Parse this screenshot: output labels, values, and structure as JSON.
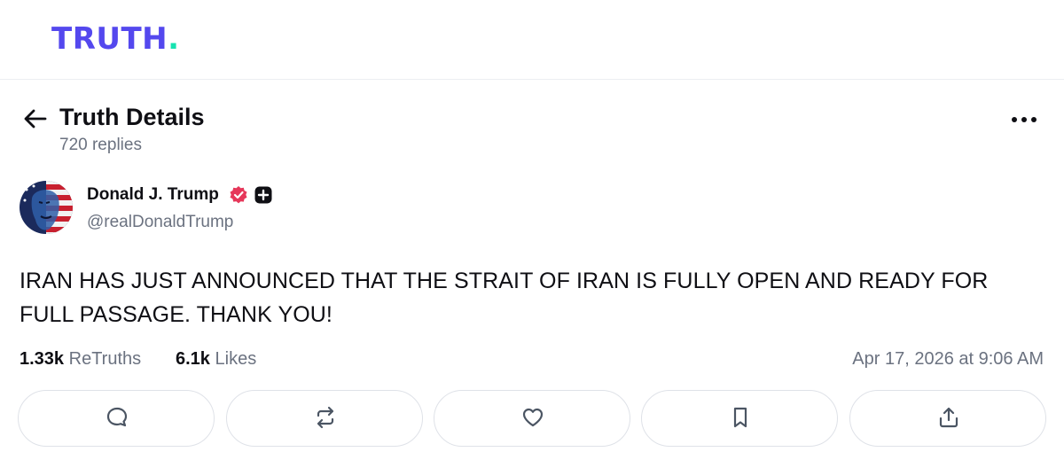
{
  "brand": {
    "logo_text": "TRUTH",
    "logo_dot": ".",
    "colors": {
      "primary": "#5448ee",
      "accent": "#17e3b0",
      "verified": "#e6375a"
    }
  },
  "header": {
    "title": "Truth Details",
    "replies": "720 replies",
    "back_icon": "arrow-left-icon",
    "more_icon": "more-horizontal-icon"
  },
  "post": {
    "author": {
      "name": "Donald J. Trump",
      "handle": "@realDonaldTrump",
      "verified": true,
      "badge": "plus-badge-icon"
    },
    "text": "IRAN HAS JUST ANNOUNCED THAT THE STRAIT OF IRAN IS FULLY OPEN AND READY FOR FULL PASSAGE. THANK YOU!",
    "stats": {
      "retruths_count": "1.33k",
      "retruths_label": "ReTruths",
      "likes_count": "6.1k",
      "likes_label": "Likes"
    },
    "timestamp": "Apr 17, 2026 at 9:06 AM"
  },
  "actions": [
    {
      "name": "reply",
      "icon": "chat-bubble-icon"
    },
    {
      "name": "retruth",
      "icon": "repost-icon"
    },
    {
      "name": "like",
      "icon": "heart-icon"
    },
    {
      "name": "bookmark",
      "icon": "bookmark-icon"
    },
    {
      "name": "share",
      "icon": "share-icon"
    }
  ]
}
